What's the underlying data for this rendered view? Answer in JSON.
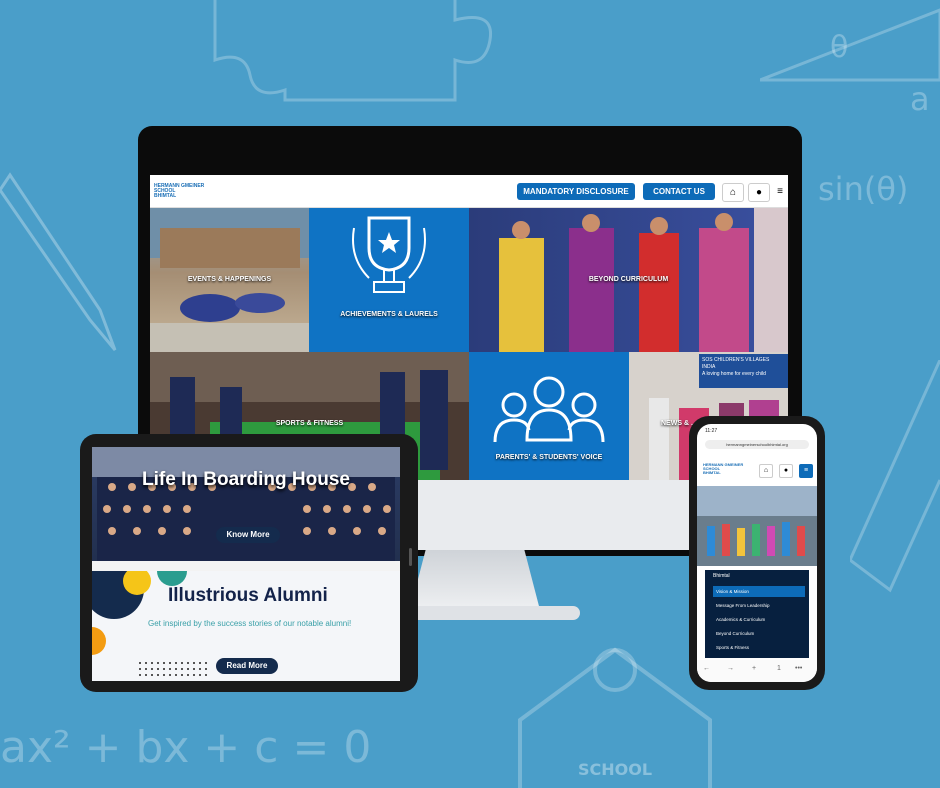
{
  "background": {
    "color": "#4a9ec9",
    "doodles": [
      "sin(θ)",
      "θ",
      "a",
      "ax² + bx + c = 0",
      "SCHOOL"
    ]
  },
  "desktop_site": {
    "logo_lines": [
      "HERMANN GMEINER",
      "SCHOOL",
      "BHIMTAL"
    ],
    "buttons": {
      "mandatory_disclosure": "MANDATORY DISCLOSURE",
      "contact_us": "CONTACT US"
    },
    "icons": [
      "home-icon",
      "user-icon",
      "menu-icon"
    ],
    "tiles": [
      {
        "label": "EVENTS & HAPPENINGS"
      },
      {
        "label": "ACHIEVEMENTS & LAURELS"
      },
      {
        "label": "BEYOND CURRICULUM"
      },
      {
        "label": "SPORTS & FITNESS"
      },
      {
        "label": "PARENTS' & STUDENTS' VOICE"
      },
      {
        "label": "NEWS & ..."
      }
    ],
    "banner_text": [
      "SOS CHILDREN'S VILLAGES",
      "INDIA",
      "A loving home for every child"
    ],
    "accent_color": "#0d6bb8"
  },
  "tablet_site": {
    "boarding_title": "Life In Boarding House",
    "know_more": "Know More",
    "alumni_title": "Illustrious Alumni",
    "alumni_subtitle": "Get inspired by the success stories of our notable alumni!",
    "read_more": "Read More"
  },
  "phone_site": {
    "time": "11:27",
    "url": "hermanngmeinerschoolbhimtal.org",
    "logo_lines": [
      "HERMANN GMEINER",
      "SCHOOL",
      "BHIMTAL"
    ],
    "menu_header": "Bhimtal",
    "menu_items": [
      "Vision & Mission",
      "Message From Leadership",
      "Academics & Curriculum",
      "Beyond Curriculum",
      "Sports & Fitness"
    ],
    "bottom_bar": [
      "←",
      "→",
      "+",
      "1",
      "•••"
    ]
  }
}
